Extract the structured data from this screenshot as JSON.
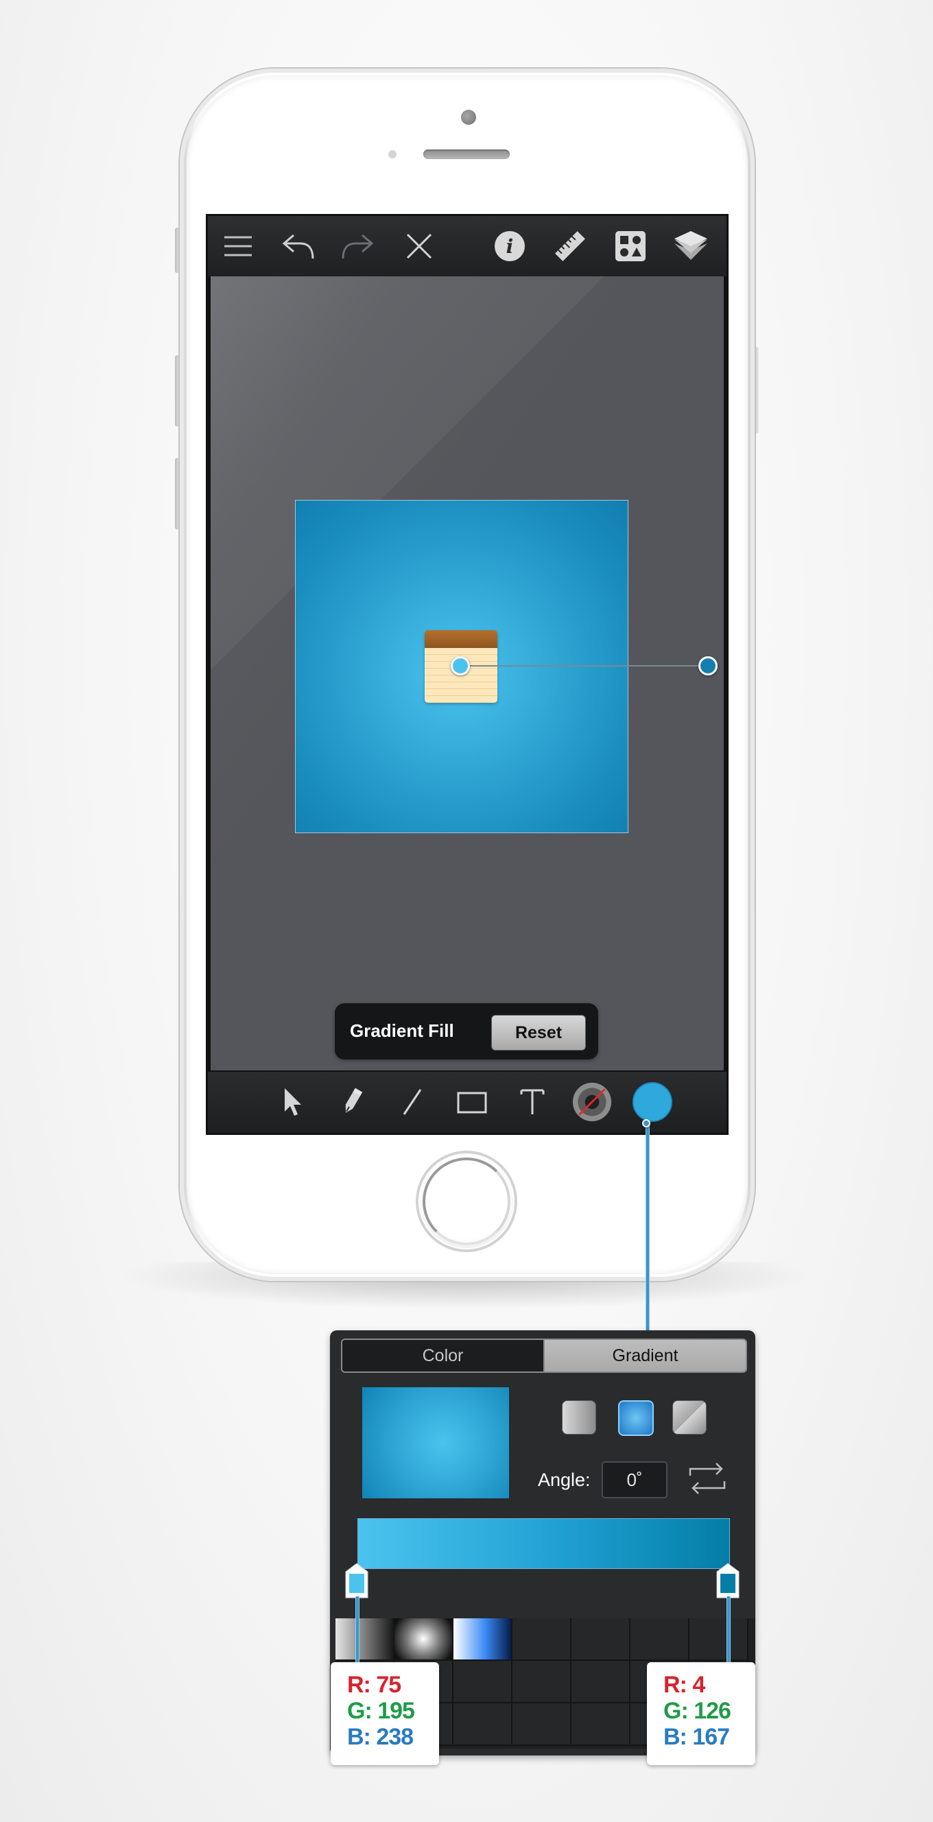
{
  "toolbar": {
    "icons": [
      "menu-icon",
      "undo-icon",
      "redo-icon",
      "close-icon",
      "info-icon",
      "ruler-icon",
      "shapes-icon",
      "layers-icon"
    ]
  },
  "hud": {
    "label": "Gradient Fill",
    "reset_label": "Reset"
  },
  "bottom_toolbar": {
    "icons": [
      "select-arrow-icon",
      "pen-icon",
      "line-icon",
      "rectangle-icon",
      "text-icon",
      "stroke-color-icon",
      "fill-color-icon"
    ],
    "fill_color": "#33aee0"
  },
  "panel": {
    "tabs": [
      "Color",
      "Gradient"
    ],
    "active_tab": "Gradient",
    "gradient_types": [
      "linear-gradient-icon",
      "radial-gradient-icon",
      "angular-gradient-icon"
    ],
    "selected_type": "radial-gradient-icon",
    "angle_label": "Angle:",
    "angle_value": "0˚",
    "gradient_start_color": "#4bc3ee",
    "gradient_end_color": "#047ea7"
  },
  "stop_left": {
    "r": "R: 75",
    "g": "G: 195",
    "b": "B: 238"
  },
  "stop_right": {
    "r": "R: 4",
    "g": "G: 126",
    "b": "B: 167"
  }
}
